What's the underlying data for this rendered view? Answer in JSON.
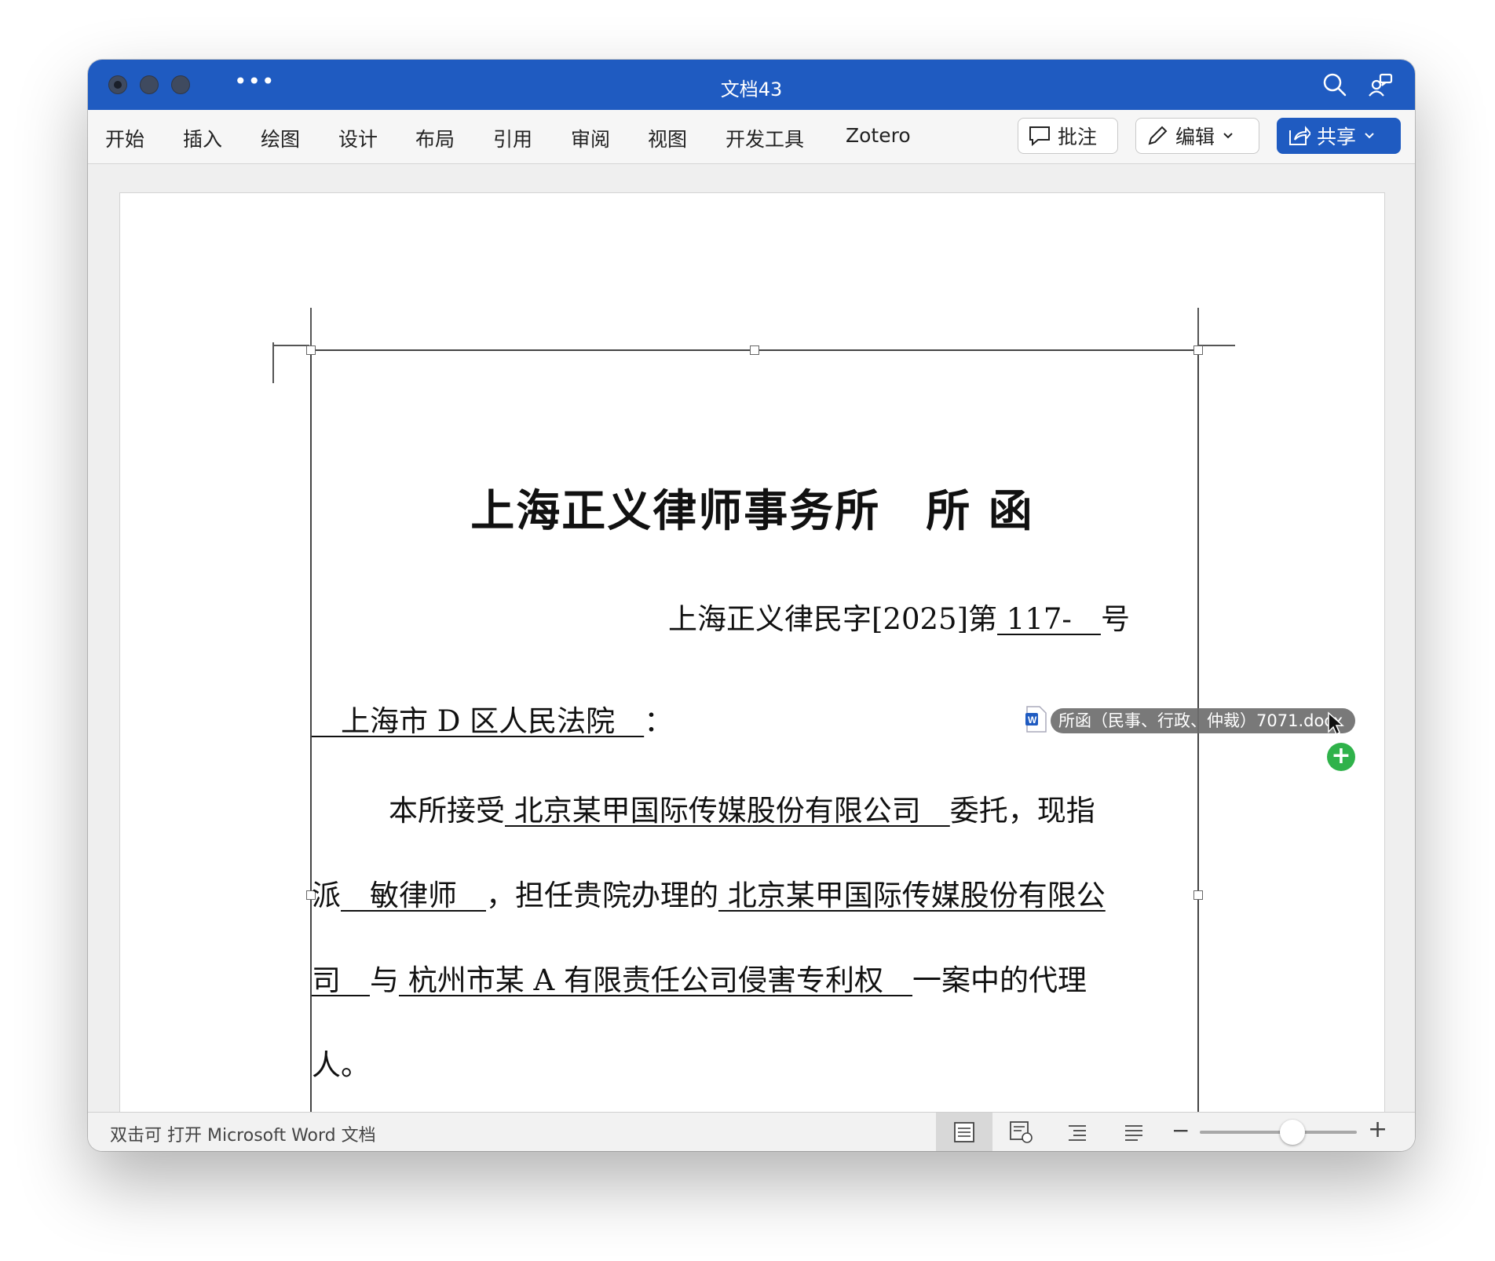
{
  "window": {
    "title": "文档43"
  },
  "ribbon": {
    "tabs": [
      "开始",
      "插入",
      "绘图",
      "设计",
      "布局",
      "引用",
      "审阅",
      "视图",
      "开发工具",
      "Zotero"
    ],
    "comment_label": "批注",
    "edit_label": "编辑",
    "share_label": "共享"
  },
  "document": {
    "title": "上海正义律师事务所　所 函",
    "ref": {
      "prefix": "上海正义律民字[2025]第",
      "number": " 117-　",
      "suffix": "号"
    },
    "addressee": {
      "name": "　上海市 D 区人民法院　",
      "colon": "："
    },
    "p1": {
      "lead": "本所接受",
      "client": " 北京某甲国际传媒股份有限公司　",
      "tail": "委托，现指"
    },
    "p2": {
      "lead": "派",
      "lawyer": "　敏律师　",
      "mid": "，担任贵院办理的",
      "case_a": " 北京某甲国际传媒股份有限公"
    },
    "p3": {
      "case_b": "司　",
      "with": "与",
      "case_c": " 杭州市某 A 有限责任公司侵害专利权　",
      "tail": "一案中的代理"
    },
    "p4": {
      "text": "人。"
    }
  },
  "drag": {
    "filename": "所函（民事、行政、仲裁）7071.docx",
    "icon": "word-doc-icon"
  },
  "statusbar": {
    "text": "双击可 打开 Microsoft Word 文档"
  },
  "colors": {
    "titlebar": "#1f5bc1",
    "share_button": "#1f5bc1",
    "plus_badge": "#2fb24a"
  }
}
